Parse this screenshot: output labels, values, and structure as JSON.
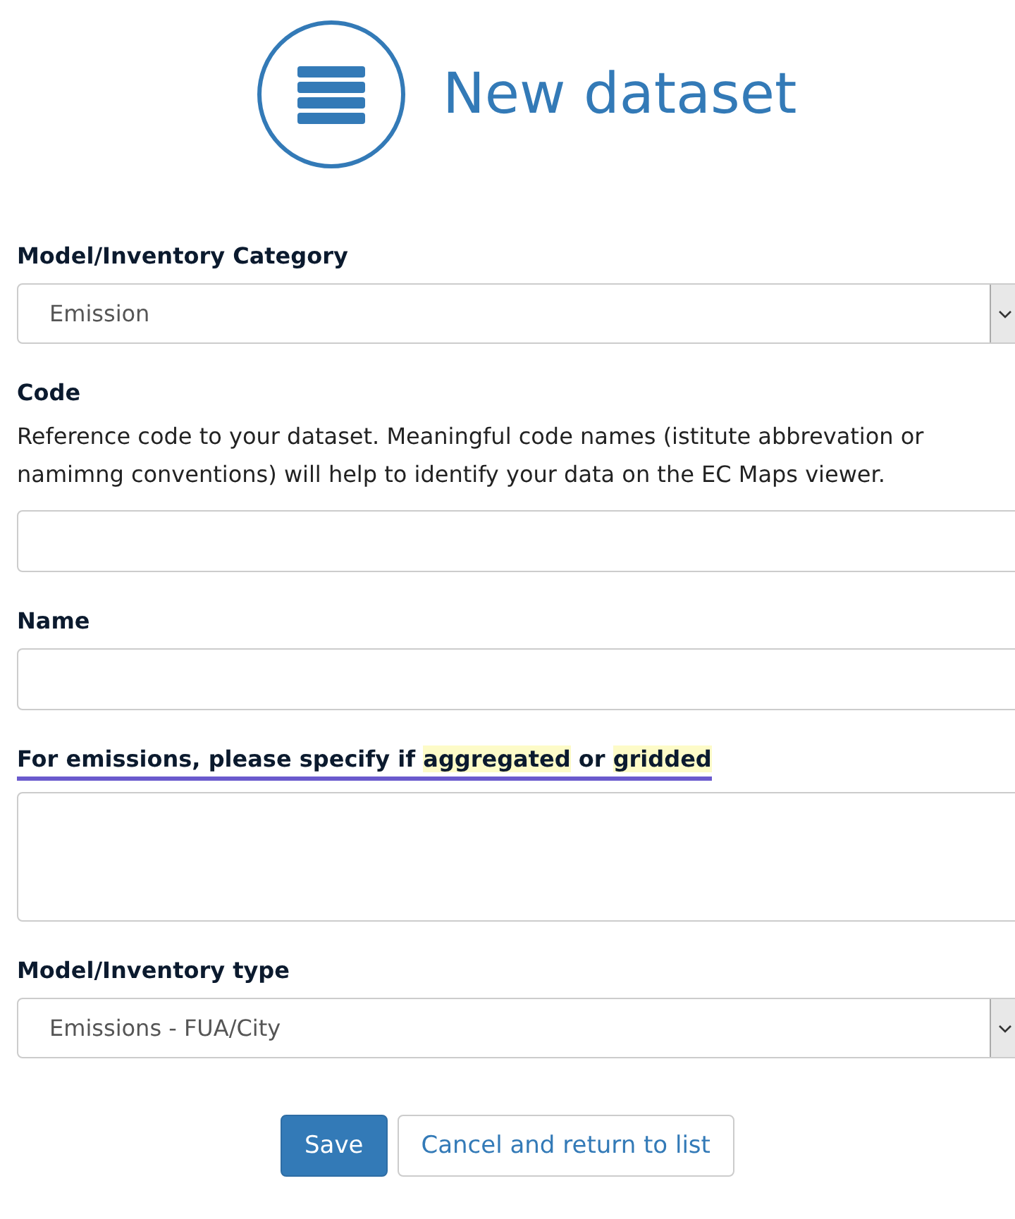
{
  "header": {
    "title": "New dataset"
  },
  "fields": [
    {
      "kind": "select",
      "label": "Model/Inventory Category",
      "value": "Emission"
    },
    {
      "kind": "input",
      "label": "Code",
      "help": "Reference code to your dataset. Meaningful code names (istitute abbrevation or namimng conventions) will help to identify your data on the EC Maps viewer."
    },
    {
      "kind": "input",
      "label": "Name"
    },
    {
      "kind": "textarea",
      "label_parts": [
        {
          "text": "For emissions, please specify if ",
          "highlight": false
        },
        {
          "text": "aggregated",
          "highlight": true
        },
        {
          "text": " or ",
          "highlight": false
        },
        {
          "text": "gridded",
          "highlight": true
        }
      ],
      "underlined": true
    },
    {
      "kind": "select",
      "label": "Model/Inventory type",
      "value": "Emissions - FUA/City"
    }
  ],
  "buttons": [
    {
      "label": "Save",
      "kind": "primary"
    },
    {
      "label": "Cancel and return to list",
      "kind": "default"
    }
  ]
}
